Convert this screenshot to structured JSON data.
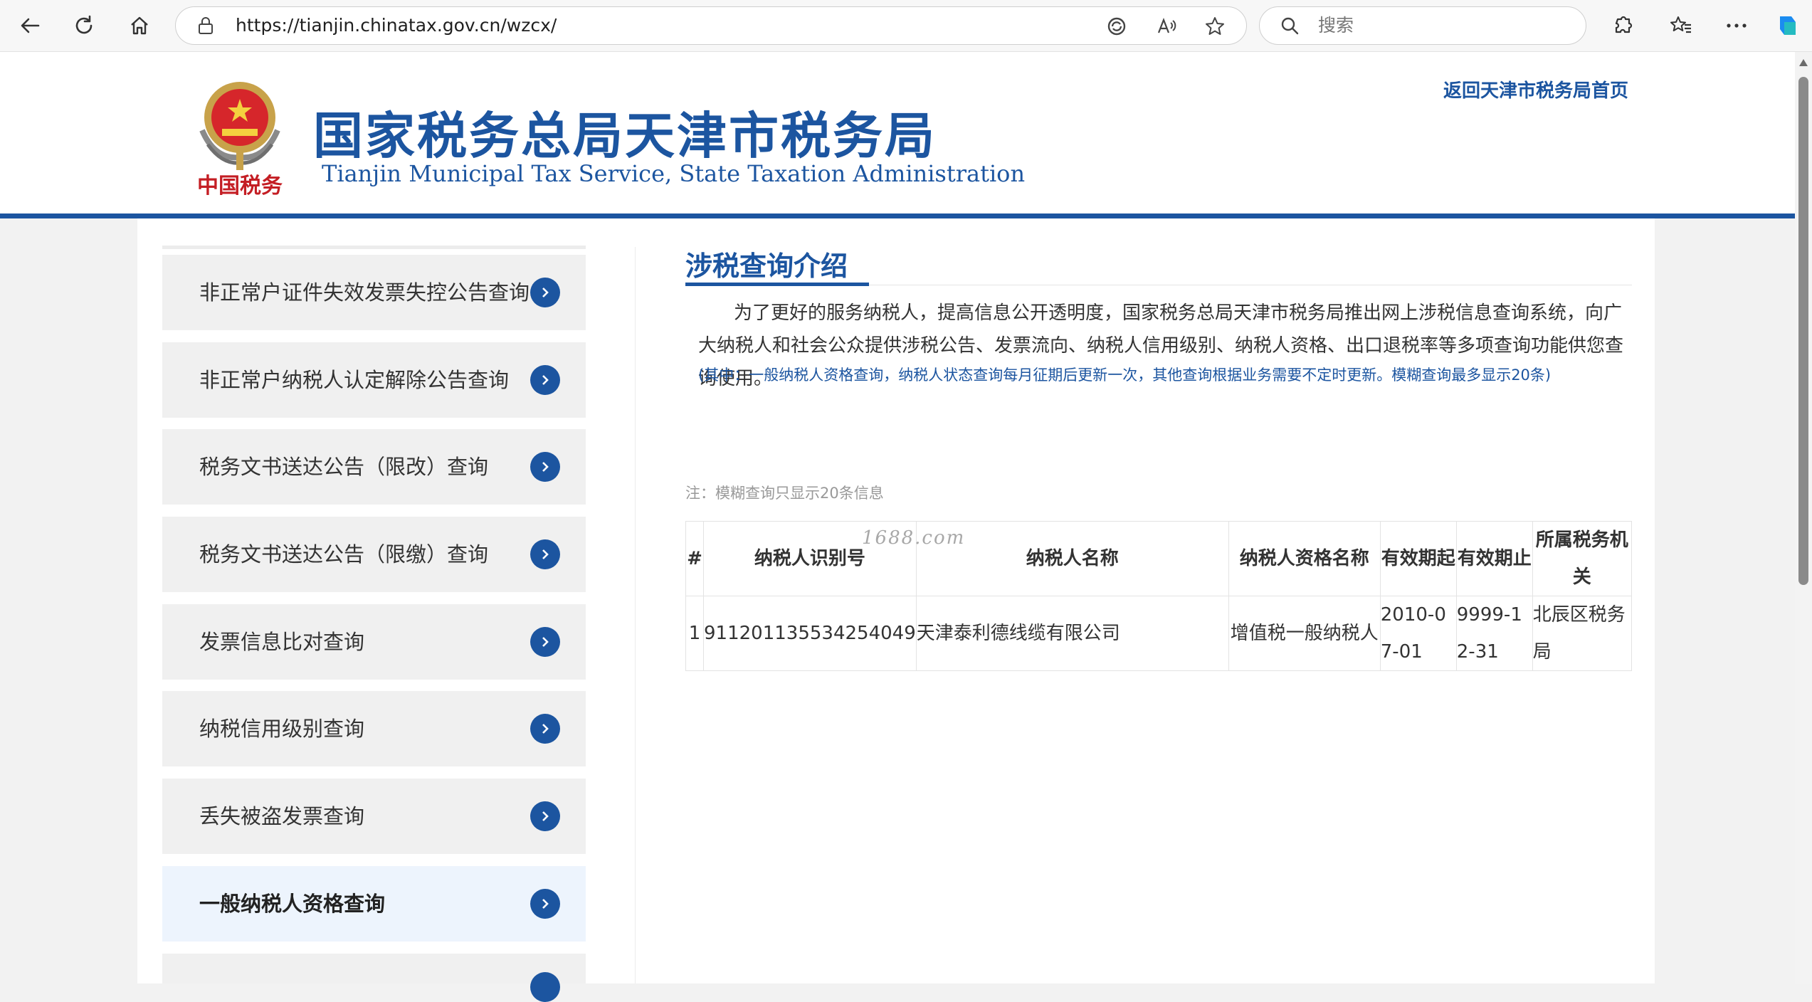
{
  "browser": {
    "url": "https://tianjin.chinatax.gov.cn/wzcx/",
    "search_placeholder": "搜索"
  },
  "header": {
    "title_cn": "国家税务总局天津市税务局",
    "title_en": "Tianjin Municipal Tax Service, State Taxation Administration",
    "emblem_text": "中国税务",
    "home_link": "返回天津市税务局首页"
  },
  "sidebar": {
    "items": [
      {
        "label": "非正常户证件失效发票失控公告查询"
      },
      {
        "label": "非正常户纳税人认定解除公告查询"
      },
      {
        "label": "税务文书送达公告（限改）查询"
      },
      {
        "label": "税务文书送达公告（限缴）查询"
      },
      {
        "label": "发票信息比对查询"
      },
      {
        "label": "纳税信用级别查询"
      },
      {
        "label": "丢失被盗发票查询"
      },
      {
        "label": "一般纳税人资格查询"
      }
    ]
  },
  "main": {
    "title": "涉税查询介绍",
    "intro": "为了更好的服务纳税人，提高信息公开透明度，国家税务总局天津市税务局推出网上涉税信息查询系统，向广大纳税人和社会公众提供涉税公告、发票流向、纳税人信用级别、纳税人资格、出口退税率等多项查询功能供您查询使用。",
    "note_blue": "(其中：一般纳税人资格查询，纳税人状态查询每月征期后更新一次，其他查询根据业务需要不定时更新。模糊查询最多显示20条)",
    "note_gray": "注：模糊查询只显示20条信息",
    "watermark": "1688.com",
    "table": {
      "headers": [
        "#",
        "纳税人识别号",
        "纳税人名称",
        "纳税人资格名称",
        "有效期起",
        "有效期止",
        "所属税务机关"
      ],
      "rows": [
        [
          "1",
          "911201135534254049",
          "天津泰利德线缆有限公司",
          "增值税一般纳税人",
          "2010-07-01",
          "9999-12-31",
          "北辰区税务局"
        ]
      ]
    }
  },
  "colors": {
    "brand": "#1c55a0",
    "active_bg": "#edf4fd"
  }
}
